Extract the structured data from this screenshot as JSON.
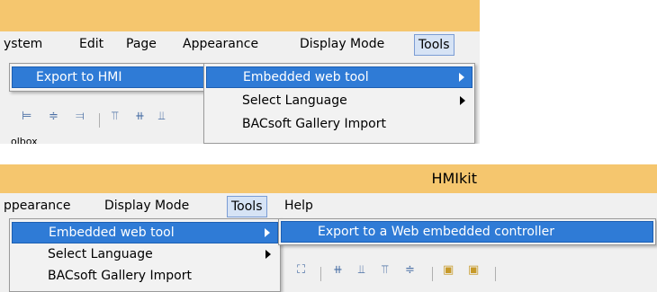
{
  "panel1": {
    "menubar": [
      "ystem",
      "Edit",
      "Page",
      "Appearance",
      "Display Mode",
      "Tools"
    ],
    "export_hmi": "Export to HMI",
    "tools_menu": [
      "Embedded web tool",
      "Select Language",
      "BACsoft Gallery Import"
    ],
    "toolbox_tab": "olbox"
  },
  "panel2": {
    "title": "HMIkit",
    "menubar": [
      "ppearance",
      "Display Mode",
      "Tools",
      "Help"
    ],
    "tools_menu": [
      "Embedded web tool",
      "Select Language",
      "BACsoft Gallery Import"
    ],
    "submenu_item": "Export to a Web embedded controller"
  },
  "colors": {
    "titlebar": "#f5c66e",
    "highlight": "#2f7bd6",
    "menu_bg": "#f0f0f0"
  },
  "icons": [
    "align-left-icon",
    "align-center-icon",
    "align-right-icon",
    "align-top-icon",
    "align-middle-icon",
    "align-bottom-icon",
    "distribute-icon",
    "bring-front-icon",
    "send-back-icon"
  ]
}
